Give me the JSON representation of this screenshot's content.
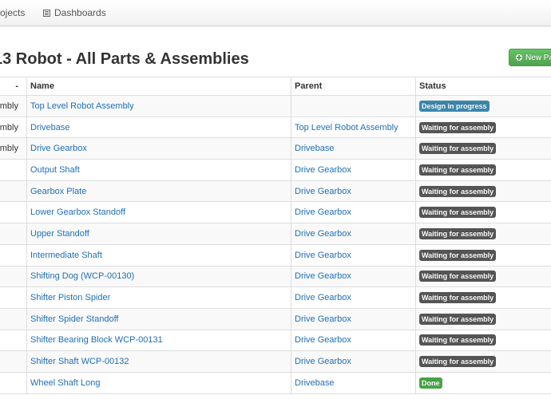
{
  "navbar": {
    "items": [
      {
        "label": "ojects"
      },
      {
        "label": "Dashboards",
        "icon": "list-icon"
      }
    ]
  },
  "page": {
    "title": "13 Robot - All Parts & Assemblies",
    "new_button_label": "New Pa",
    "new_button_icon": "plus-circle-icon"
  },
  "table": {
    "headers": {
      "type": "-",
      "name": "Name",
      "parent": "Parent",
      "status": "Status"
    },
    "rows": [
      {
        "type": "mbly",
        "name": "Top Level Robot Assembly",
        "parent": "",
        "status": "Design in progress",
        "status_color": "#3a87ad"
      },
      {
        "type": "mbly",
        "name": "Drivebase",
        "parent": "Top Level Robot Assembly",
        "status": "Waiting for assembly",
        "status_color": "#555555"
      },
      {
        "type": "mbly",
        "name": "Drive Gearbox",
        "parent": "Drivebase",
        "status": "Waiting for assembly",
        "status_color": "#555555"
      },
      {
        "type": "",
        "name": "Output Shaft",
        "parent": "Drive Gearbox",
        "status": "Waiting for assembly",
        "status_color": "#555555"
      },
      {
        "type": "",
        "name": "Gearbox Plate",
        "parent": "Drive Gearbox",
        "status": "Waiting for assembly",
        "status_color": "#555555"
      },
      {
        "type": "",
        "name": "Lower Gearbox Standoff",
        "parent": "Drive Gearbox",
        "status": "Waiting for assembly",
        "status_color": "#555555"
      },
      {
        "type": "",
        "name": "Upper Standoff",
        "parent": "Drive Gearbox",
        "status": "Waiting for assembly",
        "status_color": "#555555"
      },
      {
        "type": "",
        "name": "Intermediate Shaft",
        "parent": "Drive Gearbox",
        "status": "Waiting for assembly",
        "status_color": "#555555"
      },
      {
        "type": "",
        "name": "Shifting Dog (WCP-00130)",
        "parent": "Drive Gearbox",
        "status": "Waiting for assembly",
        "status_color": "#555555"
      },
      {
        "type": "",
        "name": "Shifter Piston Spider",
        "parent": "Drive Gearbox",
        "status": "Waiting for assembly",
        "status_color": "#555555"
      },
      {
        "type": "",
        "name": "Shifter Spider Standoff",
        "parent": "Drive Gearbox",
        "status": "Waiting for assembly",
        "status_color": "#555555"
      },
      {
        "type": "",
        "name": "Shifter Bearing Block WCP-00131",
        "parent": "Drive Gearbox",
        "status": "Waiting for assembly",
        "status_color": "#555555"
      },
      {
        "type": "",
        "name": "Shifter Shaft WCP-00132",
        "parent": "Drive Gearbox",
        "status": "Waiting for assembly",
        "status_color": "#555555"
      },
      {
        "type": "",
        "name": "Wheel Shaft Long",
        "parent": "Drivebase",
        "status": "Done",
        "status_color": "#46a546"
      }
    ]
  }
}
